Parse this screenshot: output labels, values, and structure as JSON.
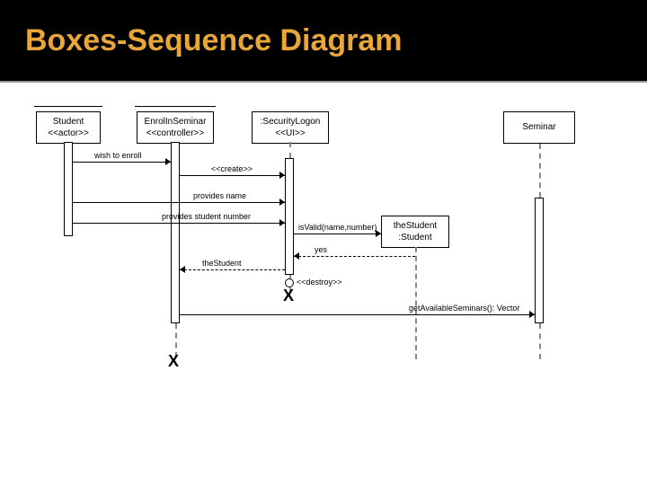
{
  "header": {
    "title": "Boxes-Sequence Diagram"
  },
  "lifelines": {
    "student": {
      "name": "Student",
      "stereotype": "<<actor>>"
    },
    "enroll": {
      "name": "EnrolInSeminar",
      "stereotype": "<<controller>>"
    },
    "security": {
      "name": ":SecurityLogon",
      "stereotype": "<<UI>>"
    },
    "theStudent": {
      "name": "theStudent",
      "type": ":Student"
    },
    "seminar": {
      "name": "Seminar"
    }
  },
  "messages": {
    "m1": "wish to enroll",
    "m2": "<<create>>",
    "m3": "provides name",
    "m4": "provides student number",
    "m5": "isValid(name,number)",
    "m6": "yes",
    "m7": "theStudent",
    "m8": "<<destroy>>",
    "m9": "getAvailableSeminars(): Vector"
  }
}
